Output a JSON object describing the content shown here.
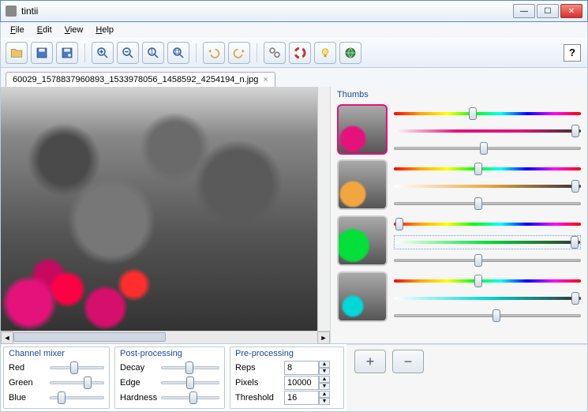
{
  "window": {
    "title": "tintii"
  },
  "menus": {
    "file": "File",
    "edit": "Edit",
    "view": "View",
    "help": "Help"
  },
  "toolbar_icons": [
    "open",
    "save",
    "saveas",
    "zoom-in",
    "zoom-out",
    "zoom-fit",
    "zoom-100",
    "undo",
    "redo",
    "settings",
    "help-buoy",
    "bulb",
    "globe"
  ],
  "help_button": "?",
  "tab": {
    "filename": "60029_1578837960893_1533978056_1458592_4254194_n.jpg",
    "close": "×"
  },
  "thumbs_panel": {
    "title": "Thumbs",
    "add": "+",
    "remove": "−"
  },
  "thumbs": [
    {
      "selected": true,
      "color": "pink",
      "s1": 42,
      "s2": 97,
      "s3": 48
    },
    {
      "selected": false,
      "color": "orange",
      "s1": 45,
      "s2": 97,
      "s3": 45
    },
    {
      "selected": false,
      "color": "green",
      "s1": 3,
      "s2": 97,
      "s3": 45,
      "focused_slider": 1
    },
    {
      "selected": false,
      "color": "cyan",
      "s1": 45,
      "s2": 97,
      "s3": 55
    }
  ],
  "channel_mixer": {
    "title": "Channel mixer",
    "red": {
      "label": "Red",
      "value": 45
    },
    "green": {
      "label": "Green",
      "value": 70
    },
    "blue": {
      "label": "Blue",
      "value": 22
    }
  },
  "post_processing": {
    "title": "Post-processing",
    "decay": {
      "label": "Decay",
      "value": 48
    },
    "edge": {
      "label": "Edge",
      "value": 50
    },
    "hardness": {
      "label": "Hardness",
      "value": 55
    }
  },
  "pre_processing": {
    "title": "Pre-processing",
    "reps": {
      "label": "Reps",
      "value": "8"
    },
    "pixels": {
      "label": "Pixels",
      "value": "10000"
    },
    "threshold": {
      "label": "Threshold",
      "value": "16"
    }
  }
}
